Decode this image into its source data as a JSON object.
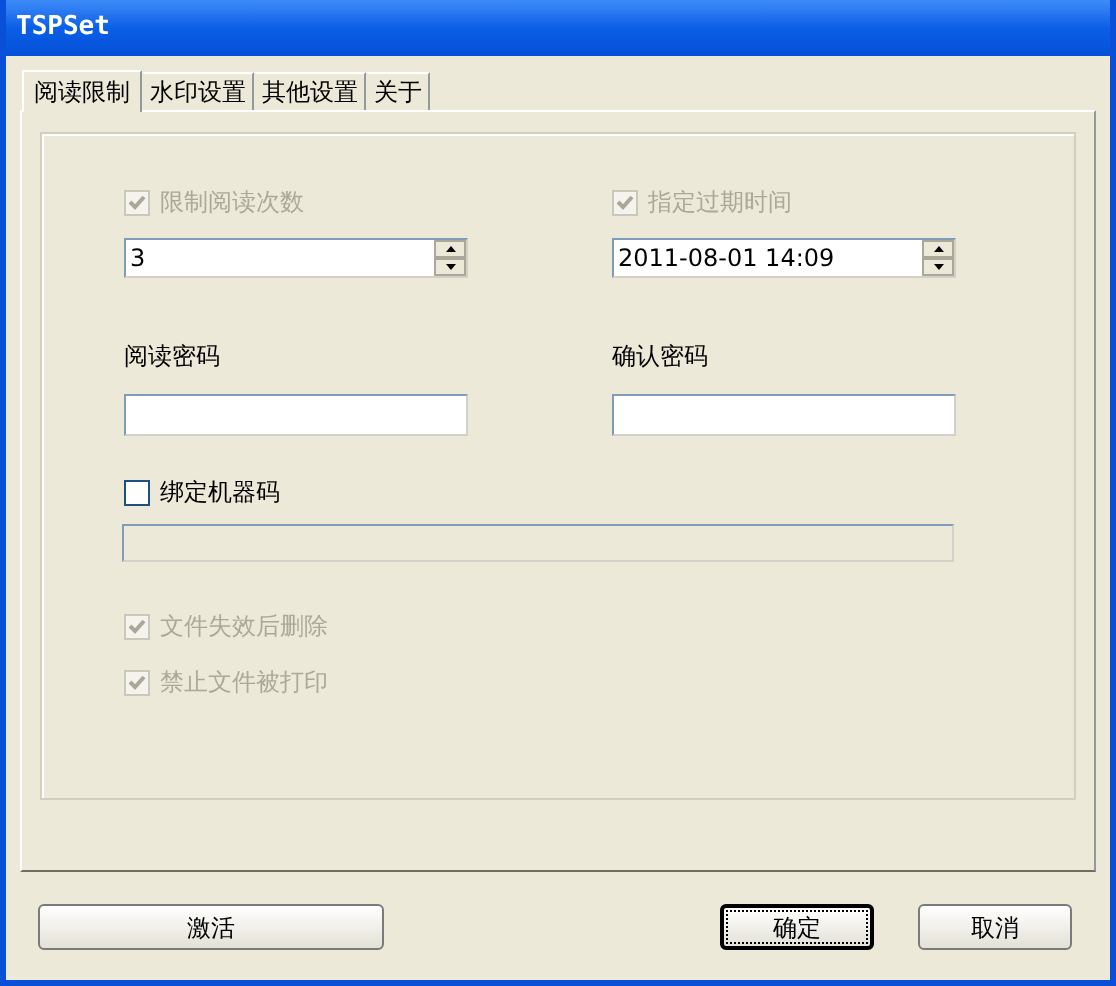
{
  "window": {
    "title": "TSPSet"
  },
  "tabs": [
    {
      "label": "阅读限制",
      "selected": true
    },
    {
      "label": "水印设置",
      "selected": false
    },
    {
      "label": "其他设置",
      "selected": false
    },
    {
      "label": "关于",
      "selected": false
    }
  ],
  "limit_reads": {
    "label": "限制阅读次数",
    "checked": true,
    "disabled": true,
    "value": "3"
  },
  "expiry": {
    "label": "指定过期时间",
    "checked": true,
    "disabled": true,
    "value": "2011-08-01 14:09"
  },
  "read_password": {
    "label": "阅读密码"
  },
  "confirm_password": {
    "label": "确认密码"
  },
  "bind_machine": {
    "label": "绑定机器码",
    "checked": false,
    "disabled": false
  },
  "machine_code": {
    "disabled": true
  },
  "options": [
    {
      "label": "文件失效后删除",
      "checked": true,
      "disabled": true
    },
    {
      "label": "禁止文件被打印",
      "checked": true,
      "disabled": true
    }
  ],
  "buttons": [
    {
      "label": "激活",
      "default": false
    },
    {
      "label": "确定",
      "default": true
    },
    {
      "label": "取消",
      "default": false
    }
  ]
}
